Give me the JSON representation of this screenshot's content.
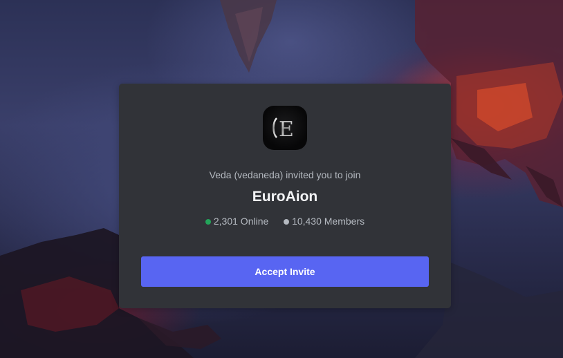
{
  "invite": {
    "inviter_text": "Veda (vedaneda) invited you to join",
    "server_name": "EuroAion",
    "online_text": "2,301 Online",
    "members_text": "10,430 Members",
    "accept_label": "Accept Invite",
    "logo_text": "E"
  },
  "colors": {
    "card_bg": "#313338",
    "accept_button": "#5865f2",
    "online_dot": "#23a55a",
    "members_dot": "#b5bac1"
  },
  "icons": {
    "server_logo": "euroaion-logo-icon",
    "online_indicator": "online-dot-icon",
    "members_indicator": "members-dot-icon"
  }
}
